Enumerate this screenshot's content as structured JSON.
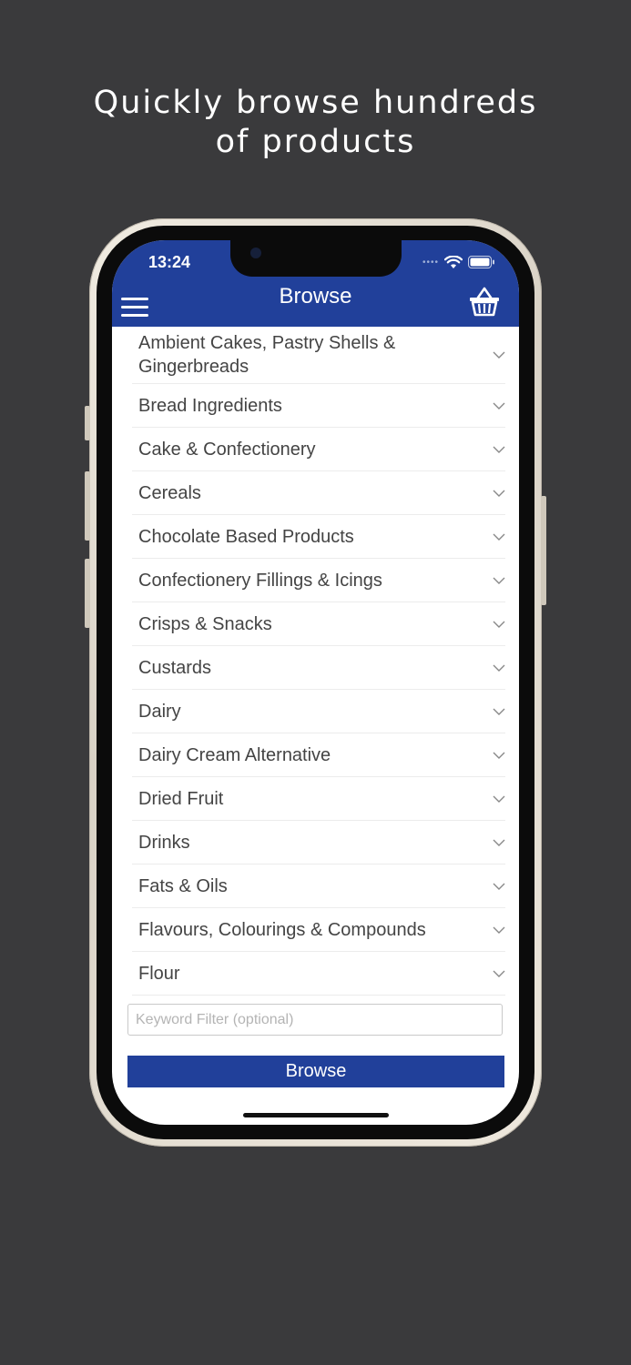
{
  "promo": {
    "headline_line1": "Quickly browse hundreds",
    "headline_line2": "of products"
  },
  "status_bar": {
    "time": "13:24"
  },
  "header": {
    "title": "Browse",
    "menu_icon": "hamburger-menu-icon",
    "basket_icon": "basket-icon"
  },
  "categories": [
    "Ambient Cakes, Pastry Shells & Gingerbreads",
    "Bread Ingredients",
    "Cake & Confectionery",
    "Cereals",
    "Chocolate Based Products",
    "Confectionery Fillings & Icings",
    "Crisps & Snacks",
    "Custards",
    "Dairy",
    "Dairy Cream Alternative",
    "Dried Fruit",
    "Drinks",
    "Fats & Oils",
    "Flavours, Colourings & Compounds",
    "Flour"
  ],
  "filter": {
    "placeholder": "Keyword Filter (optional)",
    "value": ""
  },
  "actions": {
    "browse_label": "Browse"
  },
  "colors": {
    "brand_blue": "#21409a",
    "background": "#3a3a3c"
  }
}
